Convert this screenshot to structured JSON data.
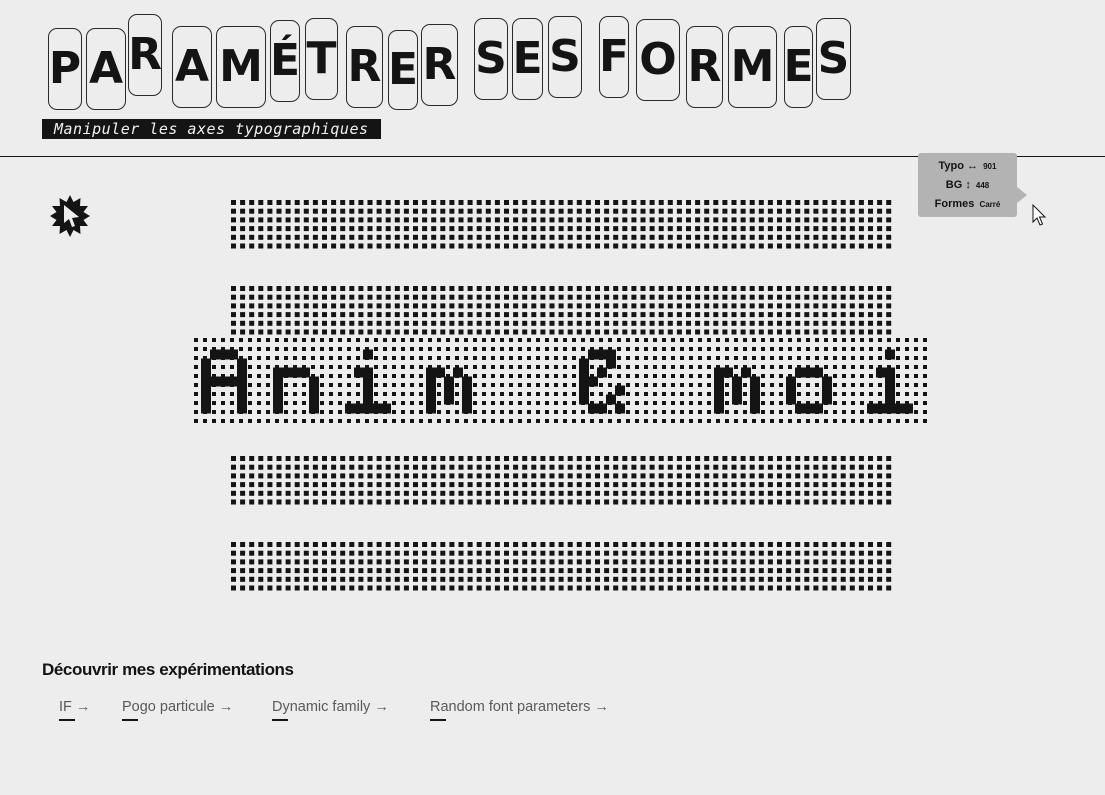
{
  "header": {
    "title_letters": [
      "P",
      "A",
      "R",
      "A",
      "M",
      "É",
      "T",
      "R",
      "E",
      "R",
      "S",
      "E",
      "S",
      "F",
      "O",
      "R",
      "M",
      "E",
      "S"
    ],
    "subtitle": "Manipuler les axes typographiques"
  },
  "badge": {
    "icon": "play-cursor-badge-icon"
  },
  "tooltip": {
    "rows": [
      {
        "label": "Typo",
        "symbol": "↔",
        "value": "901"
      },
      {
        "label": "BG",
        "symbol": "↕",
        "value": "448"
      },
      {
        "label": "Formes",
        "symbol": "",
        "value": "Carré"
      }
    ]
  },
  "cursor": {
    "icon": "mouse-pointer-icon"
  },
  "canvas": {
    "pixel_text": "Anim é moi",
    "shape": "square",
    "ink_color": "#141414"
  },
  "experiments": {
    "heading": "Découvrir mes expérimentations",
    "links": [
      {
        "label": "IF →"
      },
      {
        "label": "Pogo particule →"
      },
      {
        "label": "Dynamic family →"
      },
      {
        "label": "Random font parameters →"
      }
    ]
  }
}
